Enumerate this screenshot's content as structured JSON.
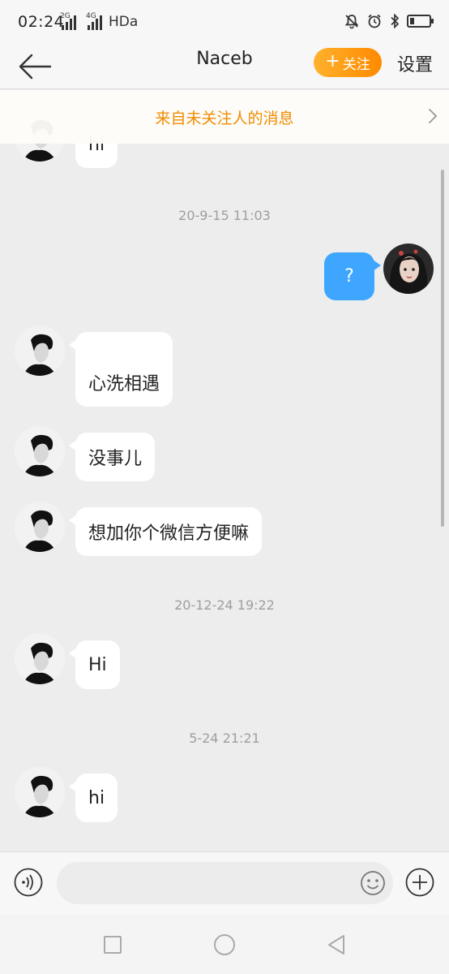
{
  "status_bar": {
    "time": "02:24",
    "signal_1_network": "2G",
    "signal_2_network": "4G",
    "hd_label": "HDa",
    "battery_percent": 15,
    "icons": [
      "mute-icon",
      "alarm-icon",
      "bluetooth-icon",
      "battery-icon"
    ]
  },
  "header": {
    "back_icon": "back-arrow-icon",
    "title": "Naceb",
    "follow_plus": "+",
    "follow_label": "关注",
    "settings_label": "设置",
    "follow_color": "#ff9500"
  },
  "notice": {
    "text": "来自未关注人的消息",
    "icon": "chevron-right-icon",
    "color": "#f08c00"
  },
  "messages": {
    "partial_hi": "hi",
    "ts1": "20-9-15 11:03",
    "out_q": "?",
    "m_xin": "心洗相遇",
    "m_meishi": "没事儿",
    "m_wechat": "想加你个微信方便嘛",
    "ts2": "20-12-24 19:22",
    "m_hi2": "Hi",
    "ts3": "5-24 21:21",
    "m_hi3": "hi",
    "outgoing_bubble_color": "#3ea6ff"
  },
  "composer": {
    "placeholder": "",
    "icons": [
      "voice-icon",
      "emoji-icon",
      "plus-icon"
    ]
  },
  "system_nav": {
    "icons": [
      "recent-apps-icon",
      "home-icon",
      "back-triangle-icon"
    ]
  }
}
